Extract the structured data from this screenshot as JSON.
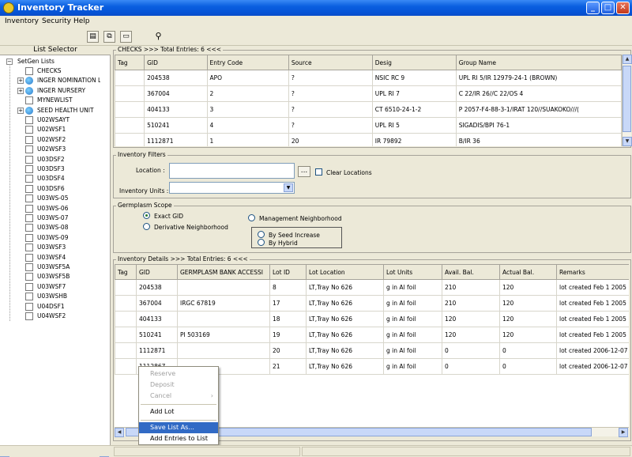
{
  "window": {
    "title": "Inventory Tracker"
  },
  "menu": [
    "Inventory",
    "Security",
    "Help"
  ],
  "left_pane": {
    "title": "List Selector",
    "root": "SetGen Lists",
    "items": [
      {
        "label": "CHECKS",
        "kind": "leaf"
      },
      {
        "label": "INGER NOMINATION LI",
        "kind": "folder"
      },
      {
        "label": "INGER NURSERY",
        "kind": "folder"
      },
      {
        "label": "MYNEWLIST",
        "kind": "leaf"
      },
      {
        "label": "SEED HEALTH UNIT",
        "kind": "folder"
      },
      {
        "label": "U02WSAYT",
        "kind": "leaf"
      },
      {
        "label": "U02WSF1",
        "kind": "leaf"
      },
      {
        "label": "U02WSF2",
        "kind": "leaf"
      },
      {
        "label": "U02WSF3",
        "kind": "leaf"
      },
      {
        "label": "U03DSF2",
        "kind": "leaf"
      },
      {
        "label": "U03DSF3",
        "kind": "leaf"
      },
      {
        "label": "U03DSF4",
        "kind": "leaf"
      },
      {
        "label": "U03DSF6",
        "kind": "leaf"
      },
      {
        "label": "U03WS-05",
        "kind": "leaf"
      },
      {
        "label": "U03WS-06",
        "kind": "leaf"
      },
      {
        "label": "U03WS-07",
        "kind": "leaf"
      },
      {
        "label": "U03WS-08",
        "kind": "leaf"
      },
      {
        "label": "U03WS-09",
        "kind": "leaf"
      },
      {
        "label": "U03WSF3",
        "kind": "leaf"
      },
      {
        "label": "U03WSF4",
        "kind": "leaf"
      },
      {
        "label": "U03WSF5A",
        "kind": "leaf"
      },
      {
        "label": "U03WSF5B",
        "kind": "leaf"
      },
      {
        "label": "U03WSF7",
        "kind": "leaf"
      },
      {
        "label": "U03WSHB",
        "kind": "leaf"
      },
      {
        "label": "U04DSF1",
        "kind": "leaf"
      },
      {
        "label": "U04WSF2",
        "kind": "leaf"
      }
    ]
  },
  "checks": {
    "legend": "CHECKS >>> Total Entries: 6 <<<",
    "columns": [
      "Tag",
      "GID",
      "Entry Code",
      "Source",
      "Desig",
      "Group Name"
    ],
    "rows": [
      [
        "",
        "204538",
        "APO",
        "?",
        "NSIC RC 9",
        "UPL RI 5/IR 12979-24-1 (BROWN)"
      ],
      [
        "",
        "367004",
        "2",
        "?",
        "UPL RI 7",
        "C 22/IR 26//C 22/OS 4"
      ],
      [
        "",
        "404133",
        "3",
        "?",
        "CT 6510-24-1-2",
        "P 2057-F4-88-3-1/IRAT 120//SUAKOKO///("
      ],
      [
        "",
        "510241",
        "4",
        "?",
        "UPL RI 5",
        "SIGADIS/BPI 76-1"
      ],
      [
        "",
        "1112871",
        "1",
        "20",
        "IR 79892",
        "B/IR 36"
      ]
    ]
  },
  "filters": {
    "legend": "Inventory Filters",
    "location_label": "Location :",
    "location_value": "",
    "browse_label": "...",
    "clear_label": "Clear Locations",
    "units_label": "Inventory Units :",
    "units_value": ""
  },
  "scope": {
    "legend": "Germplasm Scope",
    "exact": "Exact GID",
    "derivative": "Derivative Neighborhood",
    "management": "Management Neighborhood",
    "by_seed": "By Seed Increase",
    "by_hybrid": "By Hybrid",
    "selected": "exact"
  },
  "details": {
    "legend": "Inventory Details >>> Total Entries: 6 <<<",
    "columns": [
      "Tag",
      "GID",
      "GERMPLASM BANK ACCESSI",
      "Lot ID",
      "Lot Location",
      "Lot Units",
      "Avail. Bal.",
      "Actual Bal.",
      "Remarks"
    ],
    "rows": [
      [
        "",
        "204538",
        "",
        "8",
        "LT,Tray No 626",
        "g in Al foil",
        "210",
        "120",
        "lot created Feb 1 2005"
      ],
      [
        "",
        "367004",
        "IRGC 67819",
        "17",
        "LT,Tray No 626",
        "g in Al foil",
        "210",
        "120",
        "lot created Feb 1 2005"
      ],
      [
        "",
        "404133",
        "",
        "18",
        "LT,Tray No 626",
        "g in Al foil",
        "120",
        "120",
        "lot created Feb 1 2005"
      ],
      [
        "",
        "510241",
        "PI 503169",
        "19",
        "LT,Tray No 626",
        "g in Al foil",
        "120",
        "120",
        "lot created Feb 1 2005"
      ],
      [
        "",
        "1112871",
        "",
        "20",
        "LT,Tray No 626",
        "g in Al foil",
        "0",
        "0",
        "lot created 2006-12-07"
      ],
      [
        "",
        "1112867",
        "",
        "21",
        "LT,Tray No 626",
        "g in Al foil",
        "0",
        "0",
        "lot created 2006-12-07"
      ]
    ]
  },
  "context_menu": {
    "items": [
      {
        "label": "Reserve",
        "enabled": false
      },
      {
        "label": "Deposit",
        "enabled": false
      },
      {
        "label": "Cancel",
        "enabled": false,
        "submenu": true
      },
      {
        "label": "Add Lot",
        "enabled": true
      },
      {
        "label": "Save List As...",
        "enabled": true,
        "selected": true
      },
      {
        "label": "Add Entries to List",
        "enabled": true
      }
    ]
  },
  "colors": {
    "title_bar": "#0553d6",
    "selection": "#316ac5",
    "window_bg": "#ece9d8"
  }
}
